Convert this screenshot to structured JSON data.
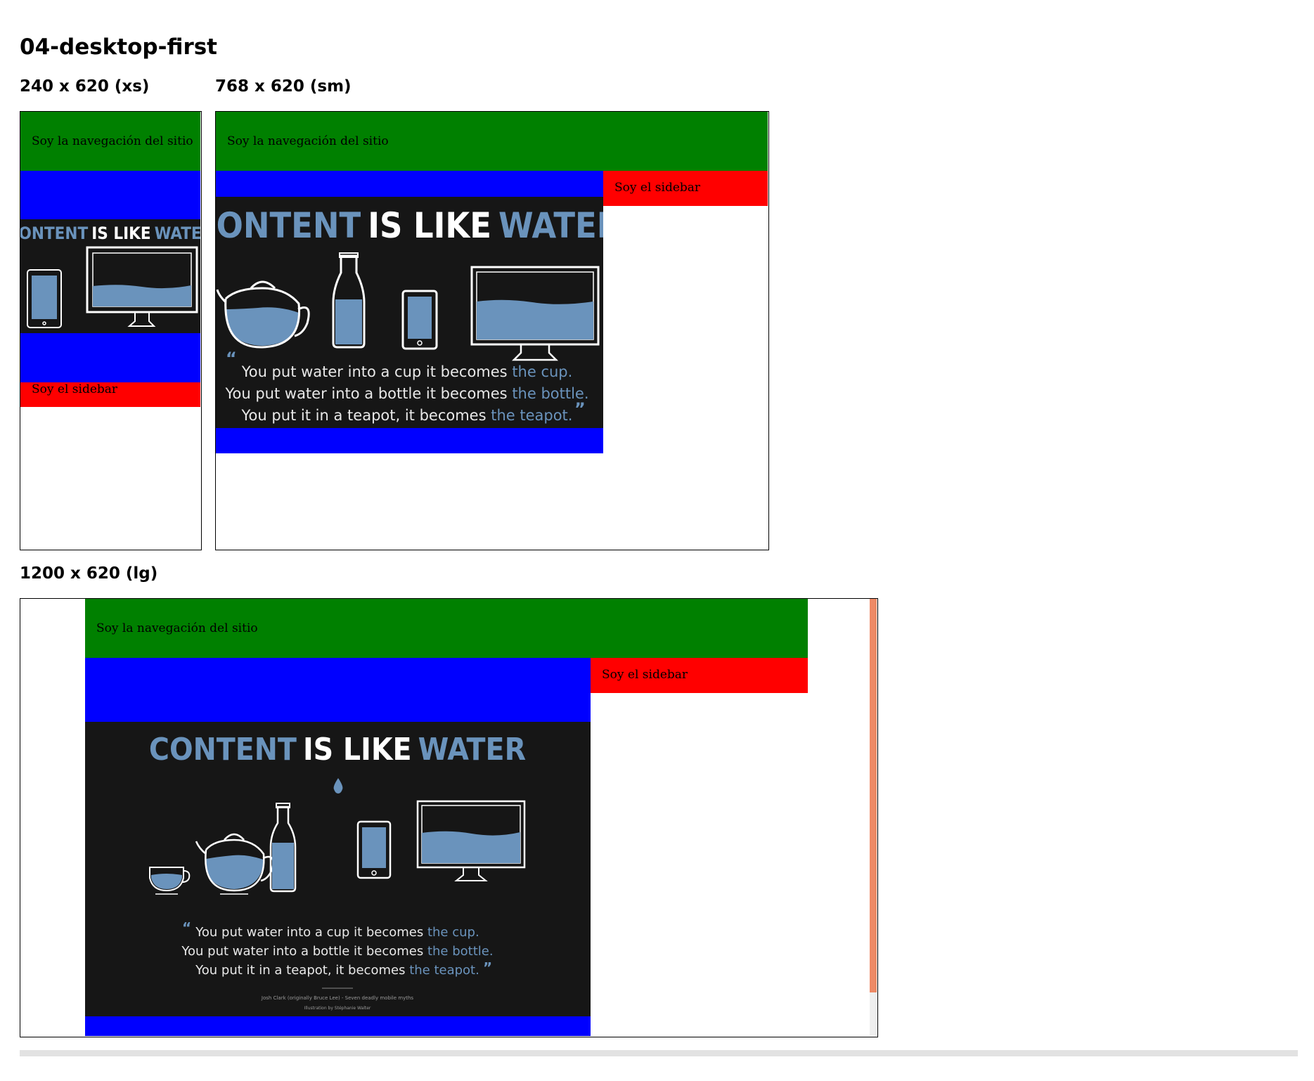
{
  "page": {
    "title": "04-desktop-first"
  },
  "frames": {
    "xs": {
      "label": "240 x 620 (xs)"
    },
    "sm": {
      "label": "768 x 620 (sm)"
    },
    "lg": {
      "label": "1200 x 620 (lg)"
    }
  },
  "site": {
    "nav_text": "Soy la navegación del sitio",
    "sidebar_text": "Soy el sidebar"
  },
  "poster": {
    "title_word_1": "CONTENT",
    "title_word_2": "IS LIKE",
    "title_word_3": "WATER",
    "quote_line_1_a": "You put water into a cup it becomes ",
    "quote_line_1_b": "the cup.",
    "quote_line_2_a": "You put water into a bottle it becomes ",
    "quote_line_2_b": "the bottle.",
    "quote_line_3_a": "You put it in a teapot, it becomes ",
    "quote_line_3_b": "the teapot.",
    "credit_1": "Josh Clark (originally Bruce Lee) - Seven deadly mobile myths",
    "credit_2": "Illustration by Stéphanie Walter"
  },
  "colors": {
    "nav": "#008000",
    "main": "#0000ff",
    "sidebar": "#ff0000",
    "poster_bg": "#161616",
    "water": "#6a93bc",
    "scroll_thumb": "#ee8a66"
  }
}
